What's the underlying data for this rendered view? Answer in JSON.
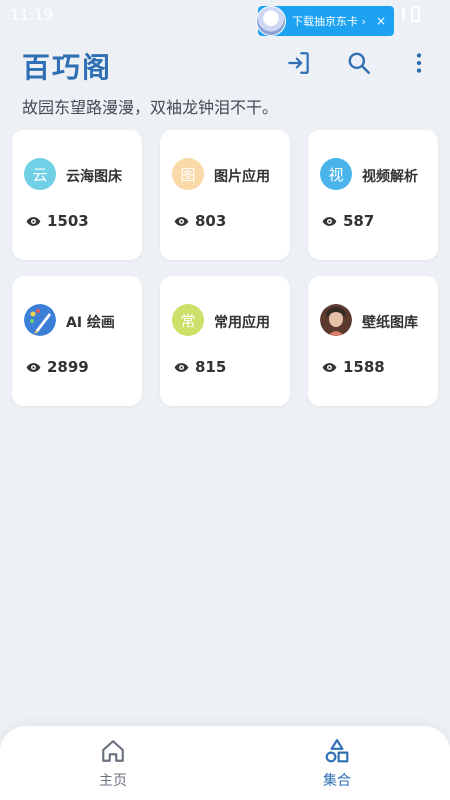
{
  "status_bar": {
    "time": "11:19"
  },
  "ad": {
    "text": "下载抽京东卡 ›",
    "close": "×"
  },
  "header": {
    "title": "百巧阁",
    "subtitle": "故园东望路漫漫，双袖龙钟泪不干。"
  },
  "colors": {
    "accent": "#2f6fb4",
    "background": "#edf1f6"
  },
  "cards": [
    {
      "icon": "云",
      "icon_color": "#6fd0e6",
      "title": "云海图床",
      "views": "1503"
    },
    {
      "icon": "图",
      "icon_color": "#fad9a9",
      "title": "图片应用",
      "views": "803"
    },
    {
      "icon": "视",
      "icon_color": "#49b3ea",
      "title": "视频解析",
      "views": "587"
    },
    {
      "icon": "",
      "icon_color": "#3c7fd6",
      "icon_name": "brush-palette-icon",
      "title": "AI 绘画",
      "views": "2899"
    },
    {
      "icon": "常",
      "icon_color": "#cde06a",
      "title": "常用应用",
      "views": "815"
    },
    {
      "icon": "",
      "icon_color": "#8a5a44",
      "icon_name": "photo-avatar-icon",
      "title": "壁纸图库",
      "views": "1588"
    }
  ],
  "nav": [
    {
      "label": "主页",
      "icon": "home-icon",
      "color": "#6b7280"
    },
    {
      "label": "集合",
      "icon": "shapes-icon",
      "color": "#2f6fb4"
    }
  ]
}
